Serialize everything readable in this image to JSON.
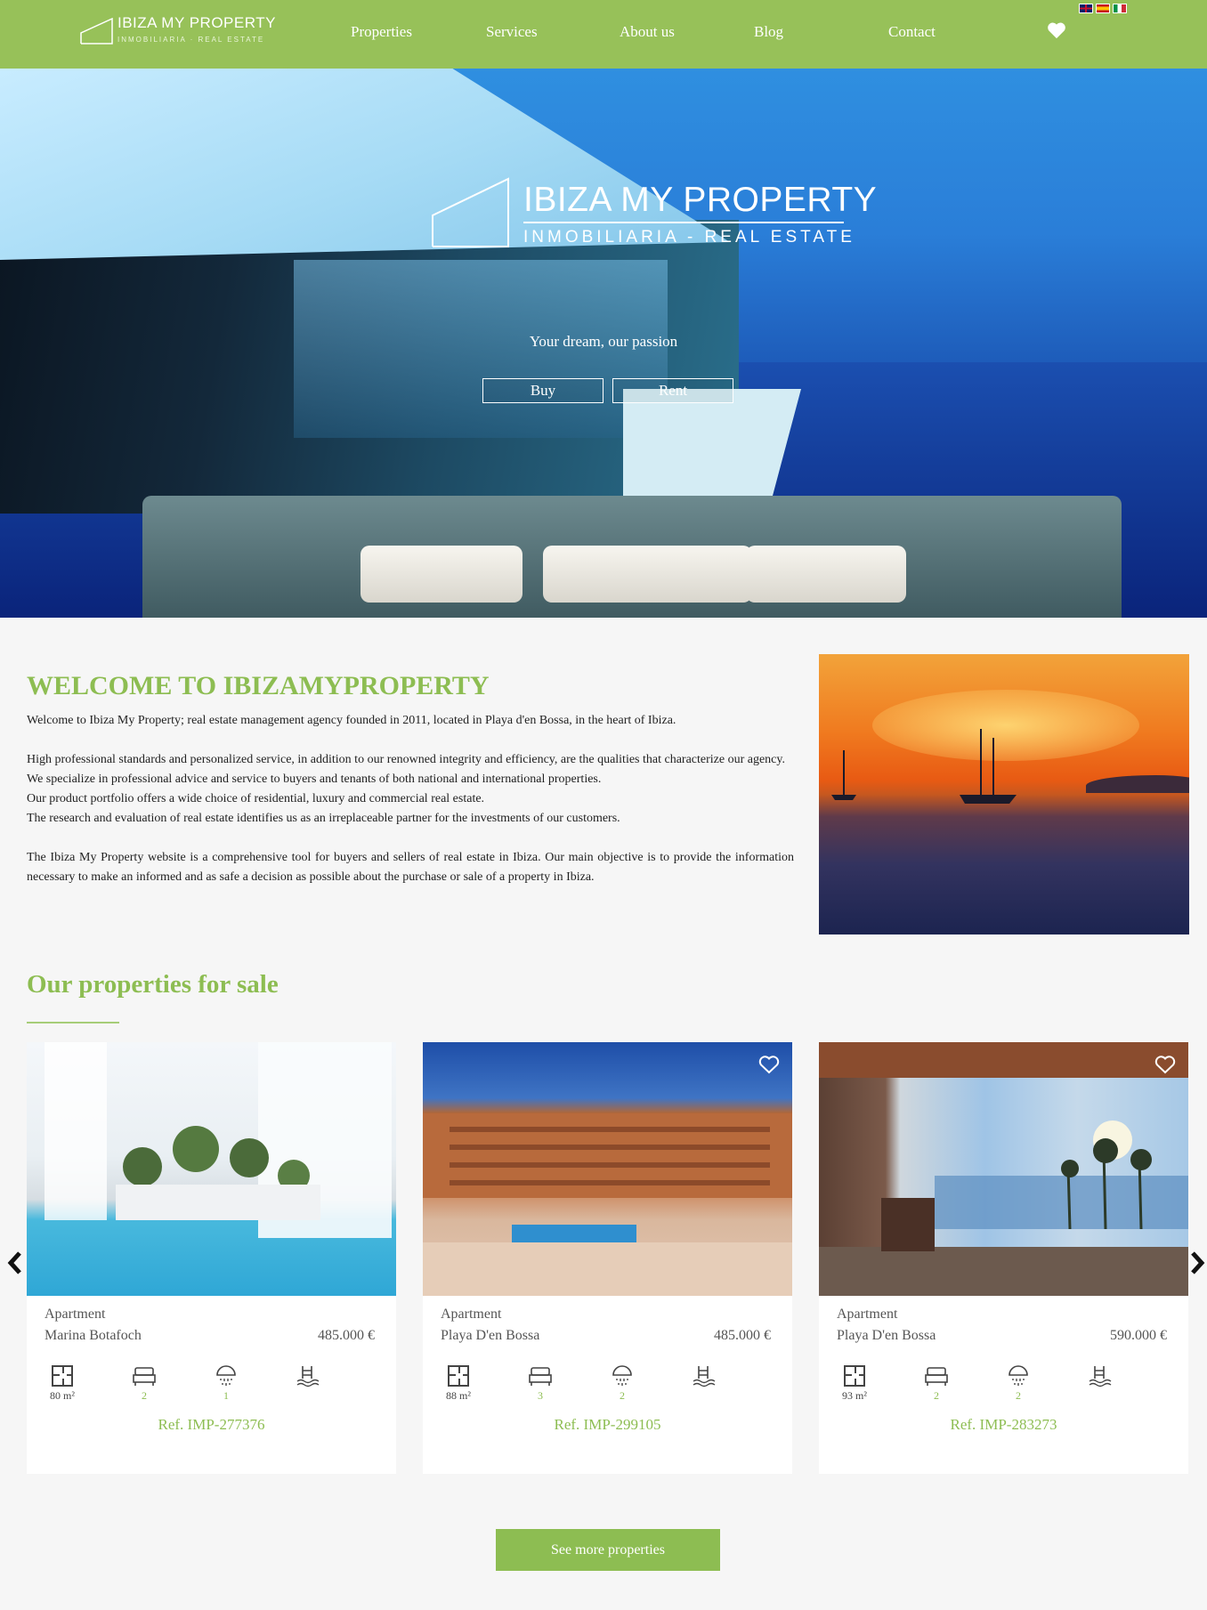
{
  "header": {
    "logo_line1": "IBIZA MY PROPERTY",
    "logo_line2": "INMOBILIARIA · REAL ESTATE",
    "nav": [
      {
        "label": "Properties"
      },
      {
        "label": "Services"
      },
      {
        "label": "About us"
      },
      {
        "label": "Blog"
      },
      {
        "label": "Contact"
      }
    ],
    "favorites_icon": "heart-icon",
    "languages": [
      "English",
      "Español",
      "Italiano"
    ]
  },
  "hero": {
    "logo_line1": "IBIZA MY PROPERTY",
    "logo_line2": "INMOBILIARIA - REAL ESTATE",
    "tagline": "Your dream, our passion",
    "buy_label": "Buy",
    "rent_label": "Rent"
  },
  "welcome": {
    "title": "WELCOME TO IBIZAMYPROPERTY",
    "paragraphs": [
      "Welcome to Ibiza My Property; real estate management agency founded in 2011, located in Playa d'en Bossa, in the heart of Ibiza.",
      "",
      "High professional standards and personalized service, in addition to our renowned integrity and efficiency, are the qualities that characterize our agency.",
      "We specialize in professional advice and service to buyers and tenants of both national and international properties.",
      "Our product portfolio offers a wide choice of residential, luxury and commercial real estate.",
      "The research and evaluation of real estate identifies us as an irreplaceable partner for the investments of our customers.",
      "",
      "The Ibiza My Property website is a comprehensive tool for buyers and sellers of real estate in Ibiza. Our main objective is to provide the information necessary to make an informed and as safe a decision as possible about the purchase or sale of a property in Ibiza."
    ]
  },
  "properties": {
    "title": "Our properties for sale",
    "items": [
      {
        "type": "Apartment",
        "location": "Marina Botafoch",
        "price": "485.000 €",
        "area": "80 m²",
        "bedrooms": "2",
        "bathrooms": "1",
        "ref": "Ref. IMP-277376",
        "favorite": false
      },
      {
        "type": "Apartment",
        "location": "Playa D'en Bossa",
        "price": "485.000 €",
        "area": "88 m²",
        "bedrooms": "3",
        "bathrooms": "2",
        "ref": "Ref. IMP-299105",
        "favorite": true
      },
      {
        "type": "Apartment",
        "location": "Playa D'en Bossa",
        "price": "590.000 €",
        "area": "93 m²",
        "bedrooms": "2",
        "bathrooms": "2",
        "ref": "Ref. IMP-283273",
        "favorite": true
      }
    ],
    "more_label": "See more properties"
  },
  "colors": {
    "brand_green": "#97c159",
    "title_green": "#8dbd52"
  }
}
